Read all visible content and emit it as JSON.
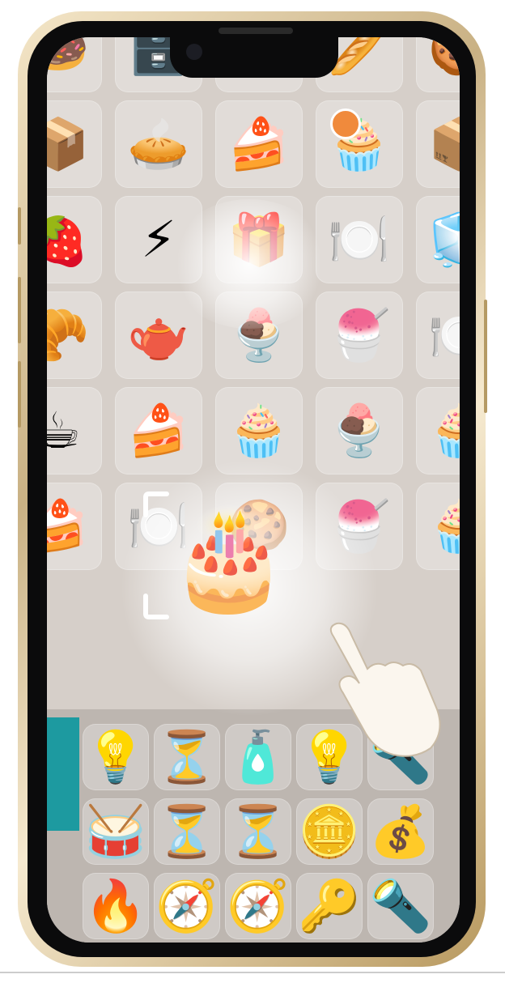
{
  "game": {
    "title": "",
    "board_top_items": [
      {
        "name": "donut-tile",
        "glyph": "🍩"
      },
      {
        "name": "pastry-display-case-tile",
        "glyph": "🗄️"
      },
      {
        "name": "fruit-tart-tile",
        "glyph": "🥧"
      },
      {
        "name": "bread-tile",
        "glyph": "🥖"
      },
      {
        "name": "macaron-tile",
        "glyph": "🍪"
      },
      {
        "name": "wooden-crate-tile",
        "glyph": "📦"
      },
      {
        "name": "pie-tin-tile",
        "glyph": "🥧"
      },
      {
        "name": "cake-slice-tile",
        "glyph": "🍰"
      },
      {
        "name": "dessert-showcase-tile",
        "glyph": "🧁"
      },
      {
        "name": "wooden-crate-right-tile",
        "glyph": "📦"
      },
      {
        "name": "strawberry-tart-tile",
        "glyph": "🍓"
      },
      {
        "name": "energy-bolt-tile",
        "glyph": "⚡"
      },
      {
        "name": "golden-chest-tile",
        "glyph": "🎁"
      },
      {
        "name": "plates-tile",
        "glyph": "🍽️"
      },
      {
        "name": "glass-display-tile",
        "glyph": "🧊"
      },
      {
        "name": "eclair-tile",
        "glyph": "🥐"
      },
      {
        "name": "soup-tureen-tile",
        "glyph": "🫖"
      },
      {
        "name": "parfait-tile",
        "glyph": "🍨"
      },
      {
        "name": "ice-cream-bowl-tile",
        "glyph": "🍧"
      },
      {
        "name": "plates-right-tile",
        "glyph": "🍽️"
      },
      {
        "name": "latte-glass-tile",
        "glyph": "☕"
      },
      {
        "name": "cheesecake-tile",
        "glyph": "🍰"
      },
      {
        "name": "cupcake-liners-tile",
        "glyph": "🧁"
      },
      {
        "name": "parfait-two-tile",
        "glyph": "🍨"
      },
      {
        "name": "muffin-tile",
        "glyph": "🧁"
      },
      {
        "name": "mille-feuille-tile",
        "glyph": "🍰"
      },
      {
        "name": "plates-mid-tile",
        "glyph": "🍽️"
      },
      {
        "name": "macaron-stack-tile",
        "glyph": "🍪"
      },
      {
        "name": "ice-cream-bowl-two-tile",
        "glyph": "🍧"
      },
      {
        "name": "cupcake-liners-right-tile",
        "glyph": "🧁"
      }
    ],
    "featured_item": {
      "name": "tiered-cake",
      "glyph": "🎂"
    },
    "board_bottom_items": [
      {
        "name": "desk-lamp-tile",
        "glyph": "💡"
      },
      {
        "name": "hourglass-tile",
        "glyph": "⏳"
      },
      {
        "name": "perfume-bottle-tile",
        "glyph": "🧴"
      },
      {
        "name": "desk-lamp-two-tile",
        "glyph": "💡"
      },
      {
        "name": "flashlight-tile",
        "glyph": "🔦"
      },
      {
        "name": "drum-tile",
        "glyph": "🥁"
      },
      {
        "name": "hourglass-two-tile",
        "glyph": "⏳"
      },
      {
        "name": "hourglass-three-tile",
        "glyph": "⏳"
      },
      {
        "name": "gold-coins-tile",
        "glyph": "🪙"
      },
      {
        "name": "coin-pot-tile",
        "glyph": "💰"
      },
      {
        "name": "matches-tile",
        "glyph": "🔥"
      },
      {
        "name": "compass-tile",
        "glyph": "🧭"
      },
      {
        "name": "compass-two-tile",
        "glyph": "🧭"
      },
      {
        "name": "keys-tile",
        "glyph": "🔑"
      },
      {
        "name": "flashlight-two-tile",
        "glyph": "🔦"
      }
    ],
    "colors": {
      "frame_gold": "#c9b184",
      "bezel": "#0b0b0c",
      "board_top": "#d6cfc9",
      "board_bottom": "#bdb6b0",
      "accent_teal": "#1d9aa0",
      "badge_orange": "#f08a3c"
    }
  }
}
